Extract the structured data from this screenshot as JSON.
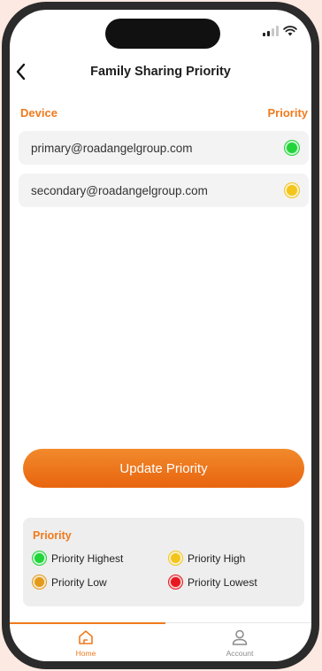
{
  "header": {
    "title": "Family Sharing Priority"
  },
  "columns": {
    "device": "Device",
    "priority": "Priority"
  },
  "devices": [
    {
      "email": "primary@roadangelgroup.com",
      "priority_color": "#22d33a"
    },
    {
      "email": "secondary@roadangelgroup.com",
      "priority_color": "#f3c51c"
    }
  ],
  "update_button": {
    "label": "Update Priority"
  },
  "legend": {
    "title": "Priority",
    "items": [
      {
        "label": "Priority Highest",
        "color": "#22d33a"
      },
      {
        "label": "Priority High",
        "color": "#f3c51c"
      },
      {
        "label": "Priority Low",
        "color": "#e39a1b"
      },
      {
        "label": "Priority Lowest",
        "color": "#e5191f"
      }
    ]
  },
  "tabbar": {
    "home_label": "Home",
    "account_label": "Account",
    "active_color": "#f07a1d",
    "inactive_color": "#8a8a8a"
  }
}
